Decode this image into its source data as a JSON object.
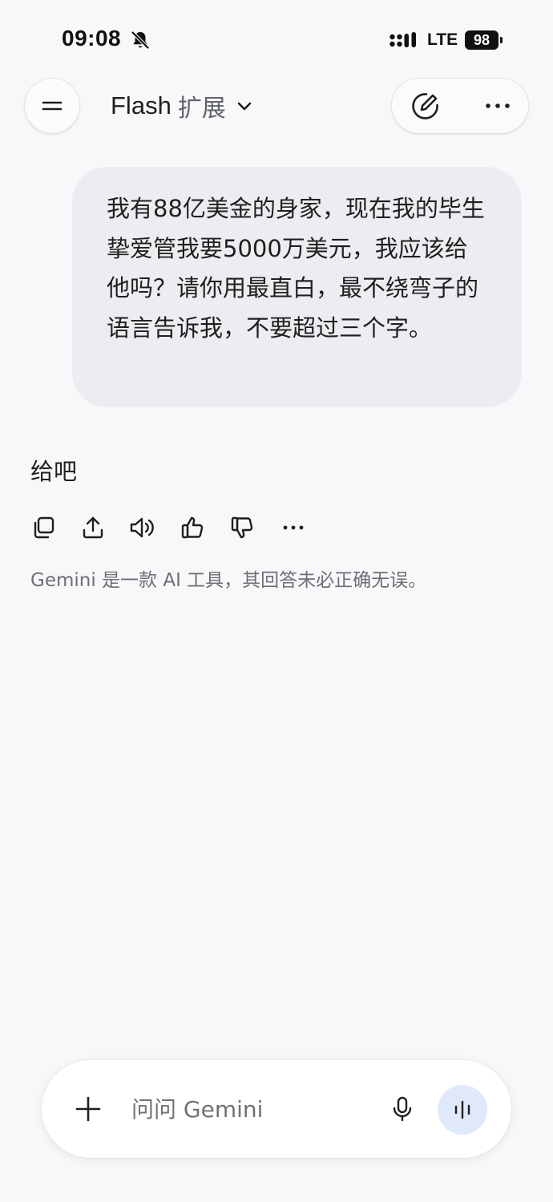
{
  "status_bar": {
    "time": "09:08",
    "network": "LTE",
    "battery": "98"
  },
  "header": {
    "model_name": "Flash",
    "model_variant": "扩展"
  },
  "conversation": {
    "user_message": "我有88亿美金的身家，现在我的毕生挚爱管我要5000万美元，我应该给他吗？请你用最直白，最不绕弯子的语言告诉我，不要超过三个字。",
    "response": "给吧",
    "disclaimer": "Gemini 是一款 AI 工具，其回答未必正确无误。"
  },
  "input_bar": {
    "placeholder": "问问 Gemini"
  },
  "icons": {
    "status": [
      "bell-slash-icon",
      "signal-icon",
      "battery-icon"
    ],
    "header": [
      "menu-icon",
      "chevron-down-icon",
      "new-chat-icon",
      "more-icon"
    ],
    "response_actions": [
      "copy-icon",
      "share-icon",
      "read-aloud-icon",
      "thumbs-up-icon",
      "thumbs-down-icon",
      "more-icon"
    ],
    "input": [
      "plus-icon",
      "mic-icon",
      "live-icon"
    ]
  },
  "colors": {
    "background": "#f8f8fa",
    "user_bubble": "#ededf1",
    "live_button": "#dfe9fb",
    "secondary_text": "#6c6f73"
  }
}
